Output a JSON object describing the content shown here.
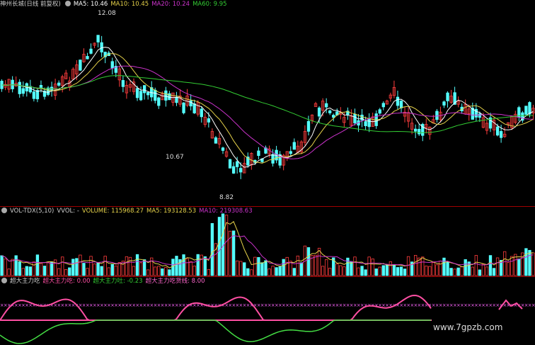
{
  "main_legend": {
    "title": "神州长城(日线 前复权)",
    "ma5": "MA5: 10.46",
    "ma10": "MA10: 10.45",
    "ma20": "MA20: 10.24",
    "ma60": "MA60: 9.95"
  },
  "price_high_label": "12.08",
  "price_low_label": "8.82",
  "price_mid_label": "10.67",
  "vol_legend": {
    "indicator": "VOL-TDX(5,10)",
    "wvol": "VVOL: -",
    "volume": "VOLUME: 115968.27",
    "ma5": "MA5: 193128.53",
    "ma10": "MA10: 219308.63"
  },
  "ind_legend": {
    "name": "超大主力吃",
    "eat": "超大主力吃: 0.00",
    "spit": "超大主力吐: -0.23",
    "line": "超大主力吃货线: 8.00"
  },
  "watermark": "www.7gpzb.com",
  "colors": {
    "up": "#ff3d3d",
    "down": "#54ffff",
    "ma5": "#ffffff",
    "ma10": "#e6d24a",
    "ma20": "#cc33cc",
    "ma60": "#33cc33",
    "separator": "#a00000"
  }
}
